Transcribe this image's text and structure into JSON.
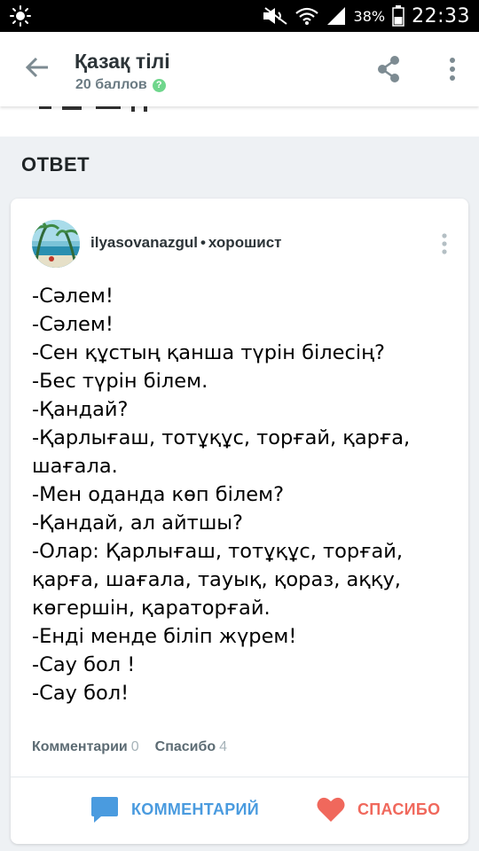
{
  "status_bar": {
    "battery_percent": "38%",
    "time": "22:33",
    "icons": [
      "brightness-icon",
      "mute-icon",
      "wifi-icon",
      "signal-icon",
      "battery-icon"
    ]
  },
  "header": {
    "title": "Қазақ тілі",
    "points": "20 баллов",
    "icons": [
      "back-arrow-icon",
      "verified-check-icon",
      "share-icon",
      "more-vertical-icon"
    ]
  },
  "section": {
    "heading": "ОТВЕТ"
  },
  "answer": {
    "author": "ilyasovanazgul",
    "separator": "•",
    "rank": "хорошист",
    "lines": [
      "-Сәлем!",
      "-Сәлем!",
      "-Сен құстың қанша түрін білесің?",
      "-Бес түрін білем.",
      "-Қандай?",
      "-Қарлығаш, тотұқұс, торғай, қарға,",
      "шағала.",
      "-Мен оданда көп білем?",
      "-Қандай, ал айтшы?",
      "-Олар: Қарлығаш, тотұқұс, торғай,",
      "қарға, шағала, тауық, қораз, аққу,",
      "көгершін, қараторғай.",
      "-Енді менде біліп жүрем!",
      "-Сау бол !",
      "-Сау бол!"
    ],
    "stats": {
      "comments_label": "Комментарии",
      "comments_count": "0",
      "thanks_label": "Спасибо",
      "thanks_count": "4"
    },
    "actions": {
      "comment_label": "КОММЕНТАРИЙ",
      "thanks_label": "СПАСИБО"
    }
  },
  "colors": {
    "accent_blue": "#4a9bdf",
    "accent_red": "#f0685c",
    "badge_green": "#6fd68c",
    "page_background": "#eef1f4"
  }
}
